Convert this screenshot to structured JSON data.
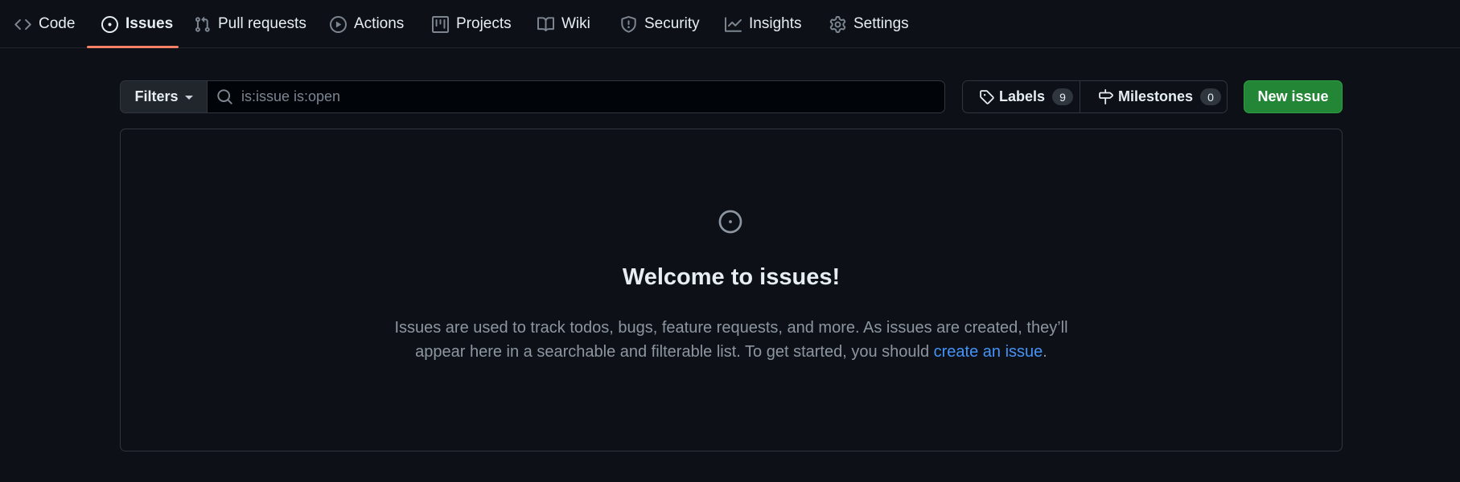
{
  "nav": {
    "tabs": [
      {
        "label": "Code",
        "icon": "code-icon"
      },
      {
        "label": "Issues",
        "icon": "issue-opened-icon",
        "active": true
      },
      {
        "label": "Pull requests",
        "icon": "git-pull-request-icon"
      },
      {
        "label": "Actions",
        "icon": "play-icon"
      },
      {
        "label": "Projects",
        "icon": "table-icon"
      },
      {
        "label": "Wiki",
        "icon": "book-icon"
      },
      {
        "label": "Security",
        "icon": "shield-icon"
      },
      {
        "label": "Insights",
        "icon": "graph-icon"
      },
      {
        "label": "Settings",
        "icon": "gear-icon"
      }
    ]
  },
  "toolbar": {
    "filters_label": "Filters",
    "search_value": "is:issue is:open",
    "labels_label": "Labels",
    "labels_count": "9",
    "milestones_label": "Milestones",
    "milestones_count": "0",
    "new_issue_label": "New issue"
  },
  "blankslate": {
    "title": "Welcome to issues!",
    "text_line1": "Issues are used to track todos, bugs, feature requests, and more. As issues are created, they’ll appear here in a searchable and filterable list. To get started, you should",
    "link_text": "create an issue",
    "text_end": "."
  },
  "colors": {
    "background": "#0d1117",
    "accent_underline": "#f78166",
    "primary_button": "#238636",
    "link": "#4493f8"
  }
}
